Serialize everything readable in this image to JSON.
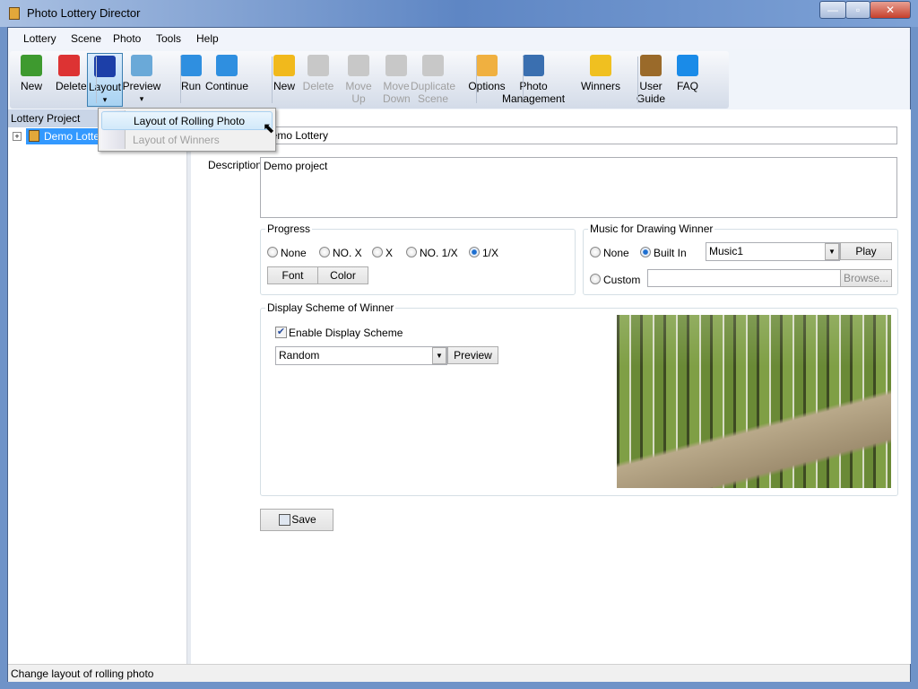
{
  "window": {
    "title": "Photo Lottery Director",
    "minimize": "—",
    "maximize": "▫",
    "close": "✕"
  },
  "menu": [
    "Lottery",
    "Scene",
    "Photo",
    "Tools",
    "Help"
  ],
  "toolbar": [
    {
      "label": "New",
      "icon": "new-lottery-icon",
      "color": "#3e9a2f"
    },
    {
      "label": "Delete",
      "icon": "delete-lottery-icon",
      "color": "#d33"
    },
    {
      "label": "Layout",
      "icon": "layout-icon",
      "color": "#1c3fa8",
      "arrow": "▾"
    },
    {
      "label": "Preview",
      "icon": "magnifier-icon",
      "color": "#6aa9d8",
      "arrow": "▾"
    },
    {
      "label": "Run",
      "icon": "play-icon",
      "color": "#2f8fe0"
    },
    {
      "label": "Continue",
      "icon": "continue-icon",
      "color": "#2f8fe0"
    },
    {
      "label": "New",
      "icon": "new-scene-icon",
      "color": "#f1b91c"
    },
    {
      "label": "Delete",
      "icon": "delete-scene-icon",
      "color": "#c8c8c8"
    },
    {
      "label": "Move Up",
      "icon": "move-up-icon",
      "color": "#c8c8c8"
    },
    {
      "label": "Move Down",
      "icon": "move-down-icon",
      "color": "#c8c8c8"
    },
    {
      "label": "Duplicate Scene",
      "icon": "duplicate-icon",
      "color": "#c8c8c8"
    },
    {
      "label": "Options",
      "icon": "wrench-icon",
      "color": "#f0b040"
    },
    {
      "label": "Photo Management",
      "icon": "people-icon",
      "color": "#3a6fb0"
    },
    {
      "label": "Winners",
      "icon": "medal-icon",
      "color": "#f0c020"
    },
    {
      "label": "User Guide",
      "icon": "book-icon",
      "color": "#9a6a2a"
    },
    {
      "label": "FAQ",
      "icon": "help-icon",
      "color": "#1a8be8"
    }
  ],
  "layout_menu": {
    "items": [
      {
        "label": "Layout of Rolling Photo",
        "enabled": true
      },
      {
        "label": "Layout of Winners",
        "enabled": false
      }
    ]
  },
  "tree": {
    "header": "Lottery Project",
    "expander": "+",
    "item": "Demo Lottery"
  },
  "form": {
    "name_value": "Demo Lottery",
    "description_label": "Description",
    "description_value": "Demo project",
    "progress": {
      "title": "Progress",
      "options": [
        "None",
        "NO. X",
        "X",
        "NO. 1/X",
        "1/X"
      ],
      "selected": "1/X",
      "font": "Font",
      "color": "Color"
    },
    "music": {
      "title": "Music for Drawing Winner",
      "none": "None",
      "builtin": "Built In",
      "selected": "Built In",
      "track": "Music1",
      "play": "Play",
      "custom": "Custom",
      "custom_path": "",
      "browse": "Browse..."
    },
    "scheme": {
      "title": "Display Scheme of Winner",
      "enable_label": "Enable Display Scheme",
      "enabled": true,
      "value": "Random",
      "preview": "Preview"
    },
    "save": "Save"
  },
  "status": "Change layout of rolling photo"
}
